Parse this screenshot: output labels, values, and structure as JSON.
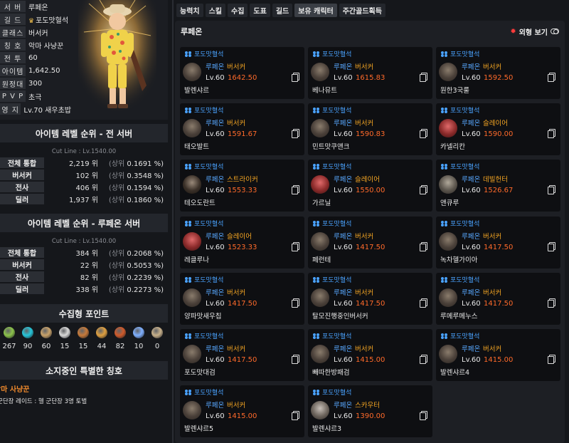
{
  "profile": {
    "rows": [
      {
        "label": "서 버",
        "value": "루페온"
      },
      {
        "label": "길 드",
        "value": "포도맛혈석"
      },
      {
        "label": "클래스",
        "value": "버서커"
      },
      {
        "label": "칭 호",
        "value": "악마 사냥꾼"
      },
      {
        "label": "전 투",
        "value": "60"
      },
      {
        "label": "아이템",
        "value": "1,642.50"
      },
      {
        "label": "원정대",
        "value": "300"
      },
      {
        "label": "P V P",
        "value": "초극"
      },
      {
        "label": "영 지",
        "value": "Lv.70 새우초밥"
      }
    ],
    "guild_icon": "crown-icon"
  },
  "rank_all": {
    "title": "아이템 레벨 순위 - 전 서버",
    "cutline": "Cut Line : Lv.1540.00",
    "rows": [
      {
        "label": "전체 통합",
        "rank": "2,219 위",
        "pct_prefix": "(상위",
        "pct": "0.1691 %)"
      },
      {
        "label": "버서커",
        "rank": "102 위",
        "pct_prefix": "(상위",
        "pct": "0.3548 %)"
      },
      {
        "label": "전사",
        "rank": "406 위",
        "pct_prefix": "(상위",
        "pct": "0.1594 %)"
      },
      {
        "label": "딜러",
        "rank": "1,937 위",
        "pct_prefix": "(상위",
        "pct": "0.1860 %)"
      }
    ]
  },
  "rank_server": {
    "title": "아이템 레벨 순위 - 루페온 서버",
    "cutline": "Cut Line : Lv.1540.00",
    "rows": [
      {
        "label": "전체 통합",
        "rank": "384 위",
        "pct_prefix": "(상위",
        "pct": "0.2068 %)"
      },
      {
        "label": "버서커",
        "rank": "22 위",
        "pct_prefix": "(상위",
        "pct": "0.5053 %)"
      },
      {
        "label": "전사",
        "rank": "82 위",
        "pct_prefix": "(상위",
        "pct": "0.2239 %)"
      },
      {
        "label": "딜러",
        "rank": "338 위",
        "pct_prefix": "(상위",
        "pct": "0.2273 %)"
      }
    ]
  },
  "collect": {
    "title": "수집형 포인트",
    "items": [
      {
        "icon": "mokoko-seed-icon",
        "value": "267",
        "color": "#8bc34a"
      },
      {
        "icon": "island-heart-icon",
        "value": "90",
        "color": "#26c6da"
      },
      {
        "icon": "great-art-icon",
        "value": "60",
        "color": "#c8a26a"
      },
      {
        "icon": "giant-heart-icon",
        "value": "15",
        "color": "#d9d9d9"
      },
      {
        "icon": "ignea-token-icon",
        "value": "15",
        "color": "#c77a3a"
      },
      {
        "icon": "adventure-book-icon",
        "value": "44",
        "color": "#e0a040"
      },
      {
        "icon": "voyage-icon",
        "value": "82",
        "color": "#d05a2a"
      },
      {
        "icon": "world-tree-leaf-icon",
        "value": "10",
        "color": "#7fb0ff"
      },
      {
        "icon": "orpheus-star-icon",
        "value": "0",
        "color": "#c7b08a"
      }
    ]
  },
  "special_title": {
    "title": "소지중인 특별한 칭호",
    "name": "악마 사냥꾼",
    "desc": "군단장 레이드 : 헬 군단장 3명 토벌"
  },
  "tabs": [
    {
      "label": "능력치",
      "active": false
    },
    {
      "label": "스킬",
      "active": false
    },
    {
      "label": "수집",
      "active": false
    },
    {
      "label": "도표",
      "active": false
    },
    {
      "label": "길드",
      "active": false
    },
    {
      "label": "보유 캐릭터",
      "active": true
    },
    {
      "label": "주간골드획득",
      "active": false
    }
  ],
  "roster": {
    "server": "루페온",
    "outfit_label": "외형 보기",
    "characters": [
      {
        "guild": "포도맛혈석",
        "server": "루페온",
        "class": "버서커",
        "level": "Lv.60",
        "item_level": "1642.50",
        "name": "발렌샤르",
        "portrait": "berserker"
      },
      {
        "guild": "포도맛혈석",
        "server": "루페온",
        "class": "버서커",
        "level": "Lv.60",
        "item_level": "1615.83",
        "name": "베나뮤트",
        "portrait": "berserker"
      },
      {
        "guild": "포도맛혈석",
        "server": "루페온",
        "class": "버서커",
        "level": "Lv.60",
        "item_level": "1592.50",
        "name": "원한3국룰",
        "portrait": "berserker"
      },
      {
        "guild": "포도맛혈석",
        "server": "루페온",
        "class": "버서커",
        "level": "Lv.60",
        "item_level": "1591.67",
        "name": "태오발트",
        "portrait": "berserker"
      },
      {
        "guild": "포도맛혈석",
        "server": "루페온",
        "class": "버서커",
        "level": "Lv.60",
        "item_level": "1590.83",
        "name": "민트맛쿠앤크",
        "portrait": "berserker"
      },
      {
        "guild": "포도맛혈석",
        "server": "루페온",
        "class": "슬레이어",
        "level": "Lv.60",
        "item_level": "1590.00",
        "name": "카넬리칸",
        "portrait": "slayer"
      },
      {
        "guild": "포도맛혈석",
        "server": "루페온",
        "class": "스트라이커",
        "level": "Lv.60",
        "item_level": "1553.33",
        "name": "테오도란트",
        "portrait": "striker"
      },
      {
        "guild": "포도맛혈석",
        "server": "루페온",
        "class": "슬레이어",
        "level": "Lv.60",
        "item_level": "1550.00",
        "name": "가르닐",
        "portrait": "slayer"
      },
      {
        "guild": "포도맛혈석",
        "server": "루페온",
        "class": "데빌헌터",
        "level": "Lv.60",
        "item_level": "1526.67",
        "name": "앤큐루",
        "portrait": "gunner"
      },
      {
        "guild": "포도맛혈석",
        "server": "루페온",
        "class": "슬레이어",
        "level": "Lv.60",
        "item_level": "1523.33",
        "name": "레클루나",
        "portrait": "slayer"
      },
      {
        "guild": "포도맛혈석",
        "server": "루페온",
        "class": "버서커",
        "level": "Lv.60",
        "item_level": "1417.50",
        "name": "페런테",
        "portrait": "berserker"
      },
      {
        "guild": "포도맛혈석",
        "server": "루페온",
        "class": "버서커",
        "level": "Lv.60",
        "item_level": "1417.50",
        "name": "녹차헬가이아",
        "portrait": "berserker"
      },
      {
        "guild": "포도맛혈석",
        "server": "루페온",
        "class": "버서커",
        "level": "Lv.60",
        "item_level": "1417.50",
        "name": "양파맛새우칩",
        "portrait": "berserker"
      },
      {
        "guild": "포도맛혈석",
        "server": "루페온",
        "class": "버서커",
        "level": "Lv.60",
        "item_level": "1417.50",
        "name": "탈모진행중인버서커",
        "portrait": "berserker"
      },
      {
        "guild": "포도맛혈석",
        "server": "루페온",
        "class": "버서커",
        "level": "Lv.60",
        "item_level": "1417.50",
        "name": "루메루메누스",
        "portrait": "berserker"
      },
      {
        "guild": "포도맛혈석",
        "server": "루페온",
        "class": "버서커",
        "level": "Lv.60",
        "item_level": "1417.50",
        "name": "포도맛대검",
        "portrait": "berserker"
      },
      {
        "guild": "포도맛혈석",
        "server": "루페온",
        "class": "버서커",
        "level": "Lv.60",
        "item_level": "1415.00",
        "name": "빼따한방패검",
        "portrait": "berserker"
      },
      {
        "guild": "포도맛혈석",
        "server": "루페온",
        "class": "버서커",
        "level": "Lv.60",
        "item_level": "1415.00",
        "name": "발렌샤르4",
        "portrait": "berserker"
      },
      {
        "guild": "포도맛혈석",
        "server": "루페온",
        "class": "버서커",
        "level": "Lv.60",
        "item_level": "1415.00",
        "name": "발렌샤르5",
        "portrait": "berserker"
      },
      {
        "guild": "포도맛혈석",
        "server": "루페온",
        "class": "스카우터",
        "level": "Lv.60",
        "item_level": "1390.00",
        "name": "발렌샤르3",
        "portrait": "scouter"
      }
    ]
  }
}
